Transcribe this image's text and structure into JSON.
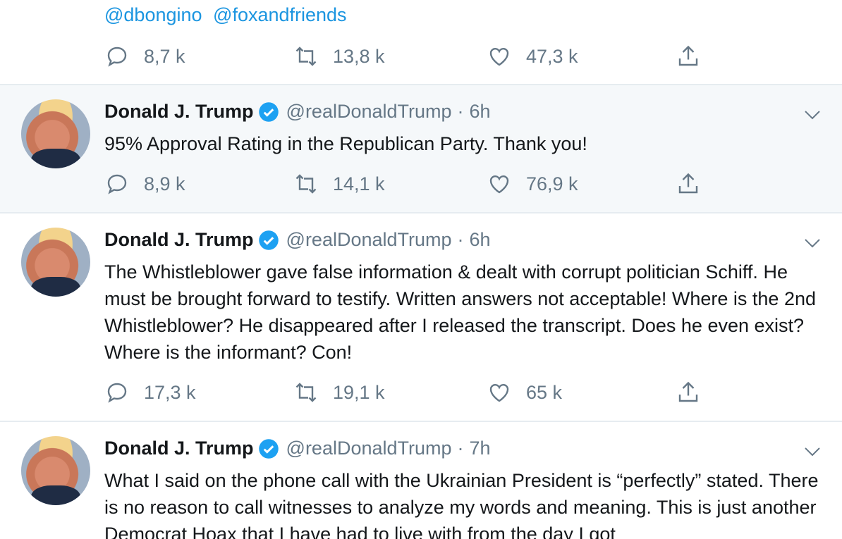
{
  "top_fragment": {
    "mentions": [
      "@dbongino",
      "@foxandfriends"
    ],
    "stats": {
      "replies": "8,7 k",
      "retweets": "13,8 k",
      "likes": "47,3 k"
    }
  },
  "tweets": [
    {
      "name": "Donald J. Trump",
      "handle": "@realDonaldTrump",
      "time": "6h",
      "text": "95% Approval Rating in the Republican Party. Thank you!",
      "replies": "8,9 k",
      "retweets": "14,1 k",
      "likes": "76,9 k"
    },
    {
      "name": "Donald J. Trump",
      "handle": "@realDonaldTrump",
      "time": "6h",
      "text": "The Whistleblower gave false information & dealt with corrupt politician Schiff. He must be brought forward to testify. Written answers not acceptable! Where is the 2nd Whistleblower? He disappeared after I released the transcript. Does he even exist? Where is the informant? Con!",
      "replies": "17,3 k",
      "retweets": "19,1 k",
      "likes": "65 k"
    },
    {
      "name": "Donald J. Trump",
      "handle": "@realDonaldTrump",
      "time": "7h",
      "text": "What I said on the phone call with the Ukrainian President is “perfectly” stated. There is no reason to call witnesses to analyze my words and meaning. This is just another Democrat Hoax that I have had to live with from the day I got"
    }
  ],
  "ui": {
    "separator_dot": "·",
    "accent_color": "#1b95e0",
    "verified_badge_color": "#1da1f2",
    "icons": [
      "reply-icon",
      "retweet-icon",
      "like-icon",
      "share-icon",
      "verified-badge-icon",
      "chevron-down-icon"
    ]
  }
}
